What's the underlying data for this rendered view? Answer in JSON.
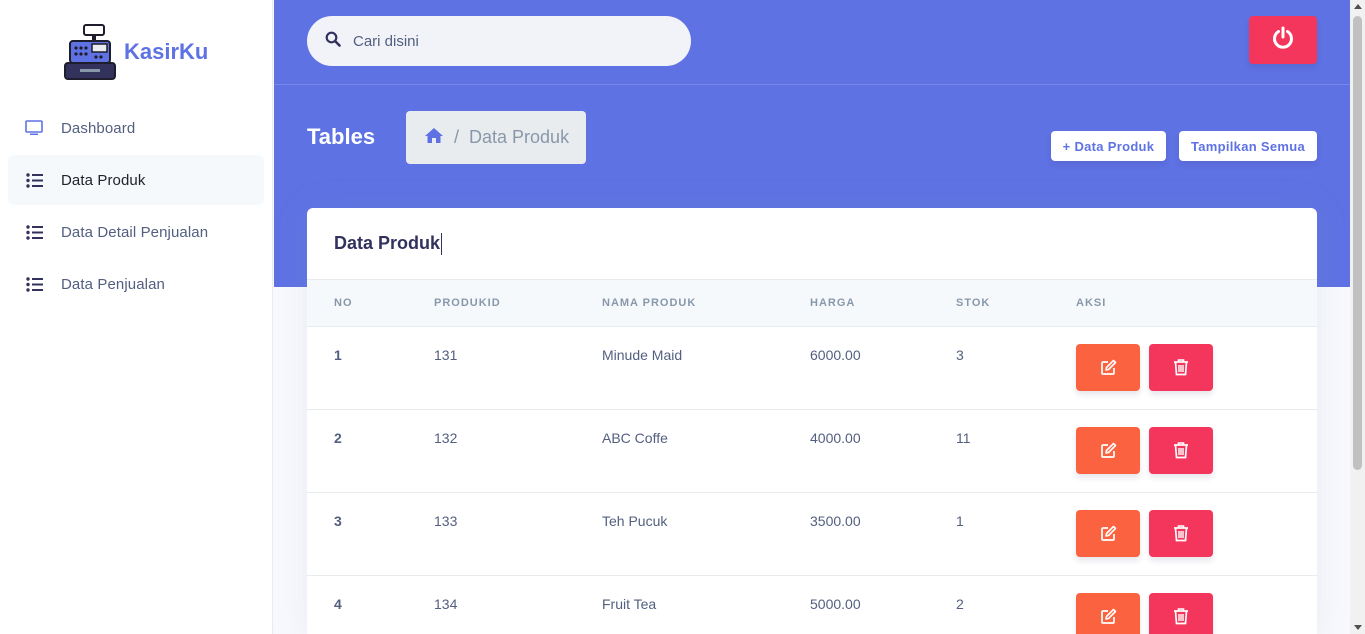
{
  "brand": {
    "name": "KasirKu"
  },
  "sidebar": {
    "items": [
      {
        "label": "Dashboard",
        "icon": "monitor-icon",
        "active": false
      },
      {
        "label": "Data Produk",
        "icon": "list-icon",
        "active": true
      },
      {
        "label": "Data Detail Penjualan",
        "icon": "list-icon",
        "active": false
      },
      {
        "label": "Data Penjualan",
        "icon": "list-icon",
        "active": false
      }
    ]
  },
  "search": {
    "placeholder": "Cari disini",
    "icon": "search-icon"
  },
  "header": {
    "title": "Tables",
    "breadcrumb": {
      "home_icon": "home-icon",
      "separator": "/",
      "current": "Data Produk"
    },
    "buttons": {
      "add": "+ Data Produk",
      "show_all": "Tampilkan Semua"
    },
    "logout_icon": "power-icon"
  },
  "card": {
    "title": "Data Produk",
    "columns": [
      "NO",
      "PRODUKID",
      "NAMA PRODUK",
      "HARGA",
      "STOK",
      "AKSI"
    ],
    "rows": [
      {
        "no": "1",
        "produkid": "131",
        "nama": "Minude Maid",
        "harga": "6000.00",
        "stok": "3"
      },
      {
        "no": "2",
        "produkid": "132",
        "nama": "ABC Coffe",
        "harga": "4000.00",
        "stok": "11"
      },
      {
        "no": "3",
        "produkid": "133",
        "nama": "Teh Pucuk",
        "harga": "3500.00",
        "stok": "1"
      },
      {
        "no": "4",
        "produkid": "134",
        "nama": "Fruit Tea",
        "harga": "5000.00",
        "stok": "2"
      }
    ]
  },
  "colors": {
    "primary": "#5e72e4",
    "danger": "#f5365c",
    "warning": "#fb6340"
  }
}
